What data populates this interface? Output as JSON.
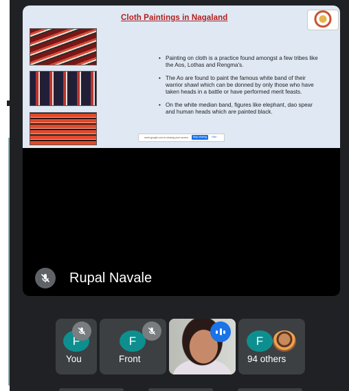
{
  "slide": {
    "title": "Cloth Paintings in Nagaland",
    "bullets": [
      "Painting on cloth is a practice found amongst a few tribes like the Aos, Lothas and Rengma's.",
      "The Ao are found to paint the famous white band of their warrior shawl which can be donned by only those who have taken heads in a battle or have performed merit feasts.",
      "On the white median band, figures like elephant, dao spear and human heads which are painted black."
    ],
    "share_bar": {
      "message": "meet.google.com is sharing your screen.",
      "stop_label": "Stop sharing",
      "hide_label": "Hide"
    }
  },
  "presenter": {
    "name": "Rupal Navale",
    "icon": "mic-off-icon"
  },
  "participants": [
    {
      "initial": "F",
      "label": "You",
      "muted": true,
      "avatar_color": "#0e8f8f"
    },
    {
      "initial": "F",
      "label": "Front",
      "muted": true,
      "avatar_color": "#0e8f8f"
    },
    {
      "label": "",
      "speaking": true,
      "video": true
    },
    {
      "initial": "F",
      "label": "94 others",
      "avatar_color": "#0e8f8f"
    }
  ],
  "colors": {
    "background": "#202124",
    "tile": "#3c4043",
    "speaking_badge": "#1a73e8",
    "slide_title": "#b21d1d"
  }
}
